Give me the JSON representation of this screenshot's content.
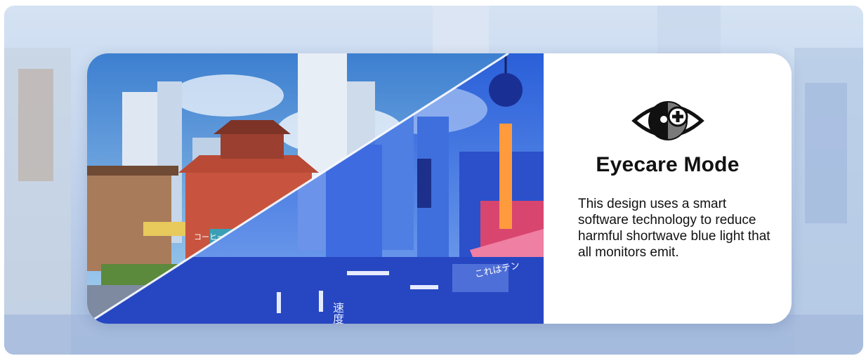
{
  "feature": {
    "icon": "eye-plus-icon",
    "title": "Eyecare Mode",
    "description": "This design uses a smart software technology to reduce harmful shortwave blue light that all monitors emit."
  },
  "illustration": {
    "signs": [
      "コーヒー",
      "これはテン",
      "速",
      "度"
    ]
  },
  "colors": {
    "card_bg": "#ffffff",
    "text": "#111111",
    "page_bg": "#c5d6ee",
    "tinted_scene": "#2a52d8"
  }
}
